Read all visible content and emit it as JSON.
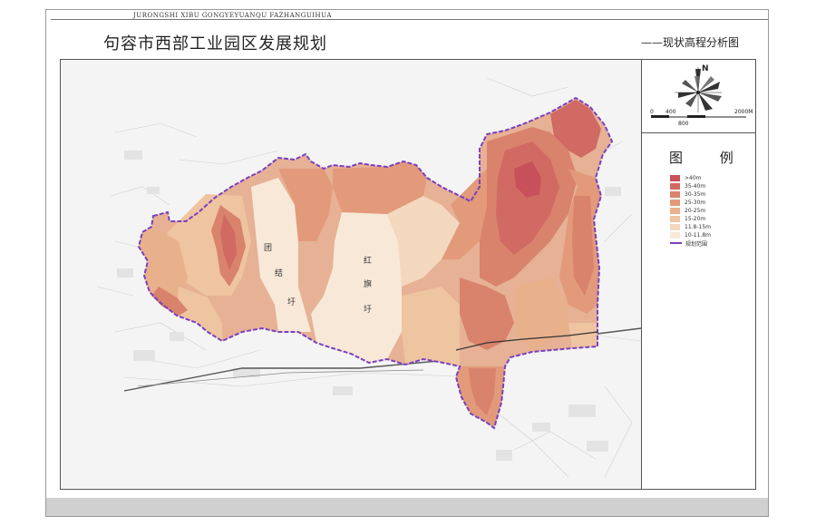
{
  "header": {
    "subtitle": "JURONGSHI XIBU GONGYEYUANQU FAZHANGUIHUA",
    "title": "句容市西部工业园区发展规划",
    "map_name": "——现状高程分析图"
  },
  "scale_bar": {
    "tick_0": "0",
    "tick_400": "400",
    "tick_800": "800",
    "tick_2000": "2000M",
    "north": "N"
  },
  "map_labels": {
    "tuanjie_1": "团",
    "tuanjie_2": "结",
    "tuanjie_3": "圩",
    "hongqi_1": "红",
    "hongqi_2": "旗",
    "hongqi_3": "圩"
  },
  "legend": {
    "title": "图  例",
    "items": [
      {
        "label": ">40m",
        "color": "#c8505a"
      },
      {
        "label": "35-40m",
        "color": "#d06a62"
      },
      {
        "label": "30-35m",
        "color": "#d9826c"
      },
      {
        "label": "25-30m",
        "color": "#e29a7a"
      },
      {
        "label": "20-25m",
        "color": "#e9b08c"
      },
      {
        "label": "15-20m",
        "color": "#efc4a0"
      },
      {
        "label": "11.8-15m",
        "color": "#f4d8bd"
      },
      {
        "label": "10-11.8m",
        "color": "#f8e8d8"
      }
    ],
    "boundary_label": "规划范围",
    "boundary_color": "#7a3fbf"
  }
}
